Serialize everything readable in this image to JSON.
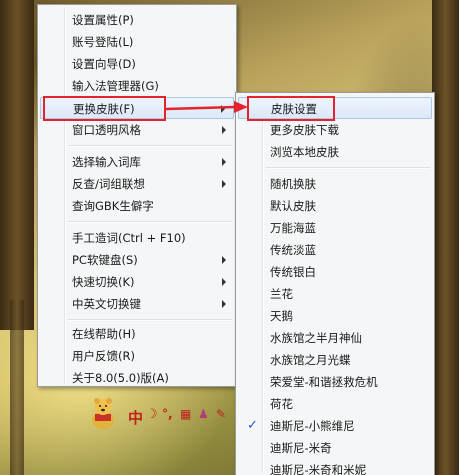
{
  "main_menu": {
    "items": [
      {
        "label": "设置属性(P)"
      },
      {
        "label": "账号登陆(L)"
      },
      {
        "label": "设置向导(D)"
      },
      {
        "label": "输入法管理器(G)"
      },
      {
        "label": "更换皮肤(F)"
      },
      {
        "label": "窗口透明风格"
      },
      {
        "label": "选择输入词库"
      },
      {
        "label": "反查/词组联想"
      },
      {
        "label": "查询GBK生僻字"
      },
      {
        "label": "手工造词(Ctrl + F10)"
      },
      {
        "label": "PC软键盘(S)"
      },
      {
        "label": "快速切换(K)"
      },
      {
        "label": "中英文切换键"
      },
      {
        "label": "在线帮助(H)"
      },
      {
        "label": "用户反馈(R)"
      },
      {
        "label": "关于8.0(5.0)版(A)"
      }
    ]
  },
  "sub_menu": {
    "items": [
      {
        "label": "皮肤设置"
      },
      {
        "label": "更多皮肤下载"
      },
      {
        "label": "浏览本地皮肤"
      },
      {
        "label": "随机换肤"
      },
      {
        "label": "默认皮肤"
      },
      {
        "label": "万能海蓝"
      },
      {
        "label": "传统淡蓝"
      },
      {
        "label": "传统银白"
      },
      {
        "label": "兰花"
      },
      {
        "label": "天鹅"
      },
      {
        "label": "水族馆之半月神仙"
      },
      {
        "label": "水族馆之月光蝶"
      },
      {
        "label": "荣爱堂-和谐拯救危机"
      },
      {
        "label": "荷花"
      },
      {
        "label": "迪斯尼-小熊维尼"
      },
      {
        "label": "迪斯尼-米奇"
      },
      {
        "label": "迪斯尼-米奇和米妮"
      }
    ],
    "checked_item": "迪斯尼-小熊维尼"
  },
  "ime_bar": {
    "mode_label": "中"
  },
  "icons": [
    "submenu-arrow-icon",
    "checkmark-icon",
    "annotation-arrow-icon",
    "moon-icon",
    "punctuation-icon",
    "keyboard-icon",
    "user-icon",
    "wrench-icon",
    "pooh-mascot-icon"
  ],
  "colors": {
    "annotation_red": "#e4232c",
    "highlight_border": "#a8c8ec",
    "check_blue": "#2058c8",
    "menu_bg": "#f5f6f7"
  }
}
